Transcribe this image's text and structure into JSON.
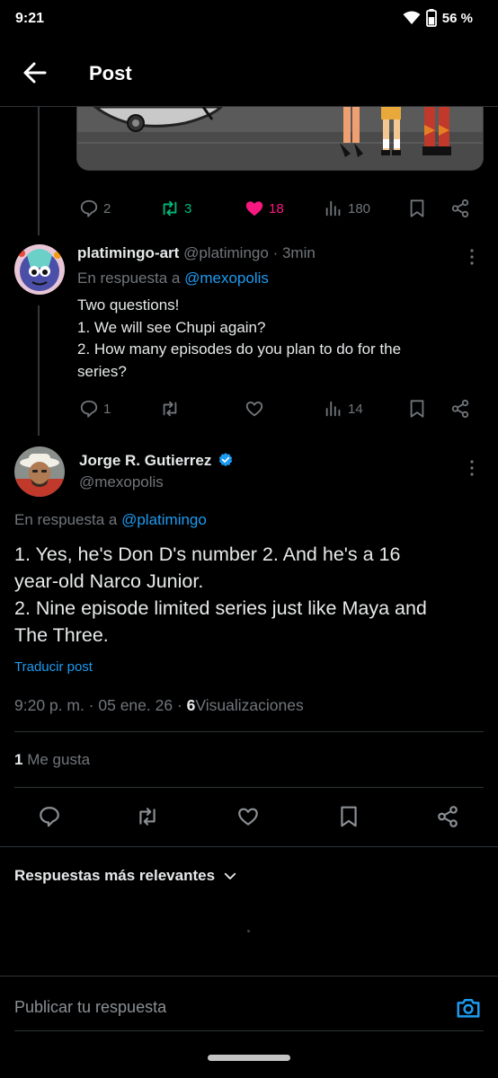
{
  "status_bar": {
    "time": "9:21",
    "battery": "56 %"
  },
  "header": {
    "title": "Post"
  },
  "parent_post": {
    "stats": {
      "replies": "2",
      "reposts": "3",
      "likes": "18",
      "views": "180"
    }
  },
  "reply": {
    "display_name": "platimingo-art",
    "handle": "@platimingo",
    "time": "· 3min",
    "reply_prefix": "En respuesta a",
    "reply_to": "@mexopolis",
    "lines": [
      "Two questions!",
      "1. We will see Chupi again?",
      "2. How many episodes do you plan to do for the",
      "series?"
    ],
    "stats": {
      "replies": "1",
      "views": "14"
    }
  },
  "main_post": {
    "display_name": "Jorge R. Gutierrez",
    "handle": "@mexopolis",
    "reply_prefix": "En respuesta a",
    "reply_to": "@platimingo",
    "lines": [
      "1. Yes, he's Don D's number 2. And he's a 16",
      "year-old Narco Junior.",
      "2. Nine episode limited series just like Maya and",
      "The Three."
    ],
    "translate": "Traducir post",
    "timestamp": "9:20 p. m. · 05 ene. 26 ·",
    "views_count": "6",
    "views_label": "Visualizaciones",
    "likes_count": "1",
    "likes_label": "Me gusta"
  },
  "replies_sort": {
    "label": "Respuestas más relevantes"
  },
  "composer": {
    "placeholder": "Publicar tu respuesta"
  },
  "colors": {
    "accent": "#1d9bf0",
    "like": "#f91880",
    "repost": "#00ba7c",
    "muted": "#71767b"
  }
}
